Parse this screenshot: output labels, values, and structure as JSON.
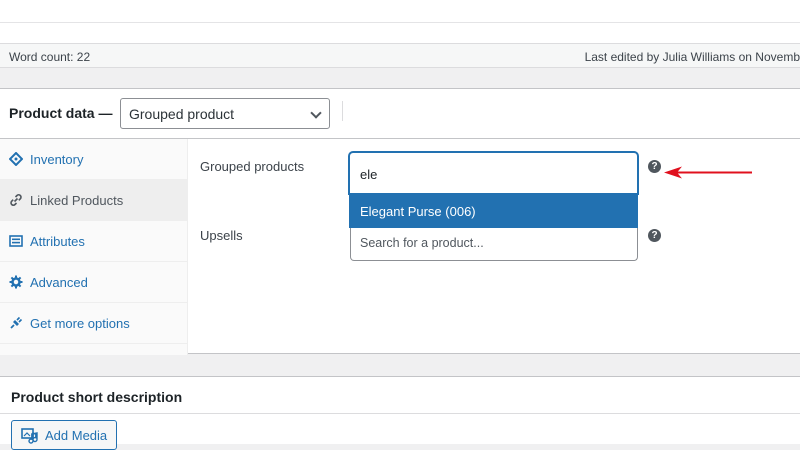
{
  "status_bar": {
    "word_count": "Word count: 22",
    "last_edited": "Last edited by Julia Williams on Novemb"
  },
  "product_data": {
    "title": "Product data —",
    "type_select": "Grouped product",
    "tabs": [
      {
        "label": "Inventory",
        "icon": "inventory-icon"
      },
      {
        "label": "Linked Products",
        "icon": "link-icon"
      },
      {
        "label": "Attributes",
        "icon": "attributes-icon"
      },
      {
        "label": "Advanced",
        "icon": "gear-icon"
      },
      {
        "label": "Get more options",
        "icon": "plugin-icon"
      }
    ],
    "grouped_products": {
      "label": "Grouped products",
      "value": "ele",
      "suggestion": "Elegant Purse (006)"
    },
    "upsells": {
      "label": "Upsells",
      "placeholder": "Search for a product..."
    }
  },
  "short_description": {
    "title": "Product short description",
    "add_media": "Add Media"
  },
  "colors": {
    "accent": "#2271b1",
    "annotation_arrow": "#e0101e"
  }
}
